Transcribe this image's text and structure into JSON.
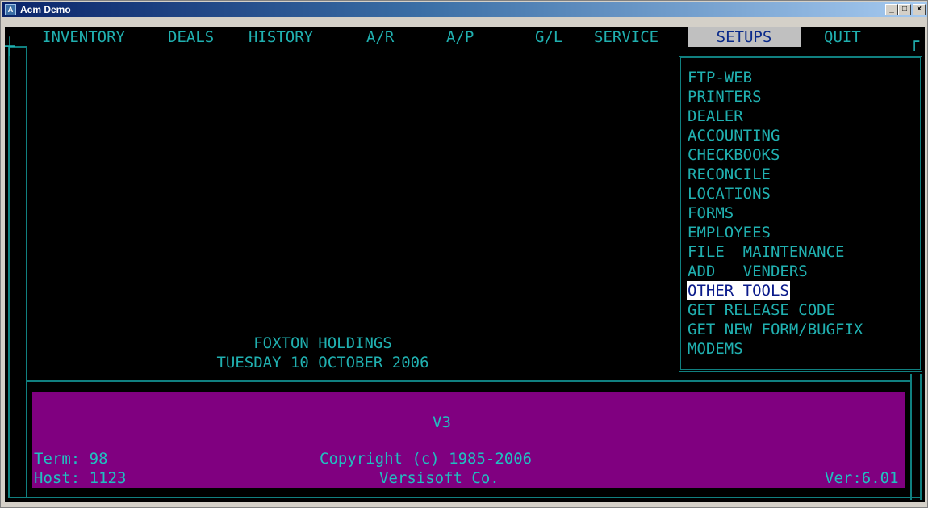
{
  "window": {
    "title": "Acm Demo",
    "buttons": {
      "minimize": "_",
      "maximize": "□",
      "close": "×"
    }
  },
  "menu": {
    "items": [
      "INVENTORY",
      "DEALS",
      "HISTORY",
      "A/R",
      "A/P",
      "G/L",
      "SERVICE",
      "SETUPS",
      "QUIT"
    ],
    "selected": "SETUPS"
  },
  "setups_menu": {
    "items": [
      "FTP-WEB",
      "PRINTERS",
      "DEALER",
      "ACCOUNTING",
      "CHECKBOOKS",
      "RECONCILE",
      "LOCATIONS",
      "FORMS",
      "EMPLOYEES",
      "FILE  MAINTENANCE",
      "ADD   VENDERS",
      "OTHER TOOLS",
      "GET RELEASE CODE",
      "GET NEW FORM/BUGFIX",
      "MODEMS"
    ],
    "highlighted": "OTHER TOOLS"
  },
  "main": {
    "company": "FOXTON HOLDINGS",
    "date": "TUESDAY 10 OCTOBER 2006"
  },
  "status": {
    "version_label": "V3",
    "term": "Term: 98",
    "host": "Host: 1123",
    "copyright": "Copyright (c) 1985-2006",
    "company": "Versisoft Co.",
    "ver": "Ver:6.01"
  },
  "colors": {
    "terminal_bg": "#000000",
    "text_cyan": "#20b0b0",
    "status_bg": "#800080",
    "selected_bg": "#c0c0c0",
    "highlight_bg": "#ffffff"
  }
}
